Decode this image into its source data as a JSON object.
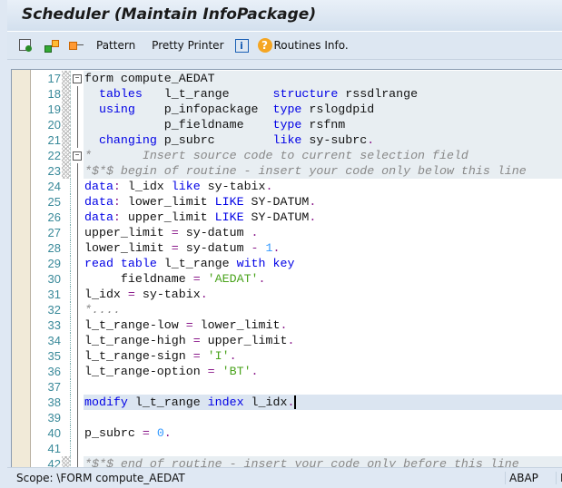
{
  "window": {
    "title": "Scheduler (Maintain InfoPackage)"
  },
  "toolbar": {
    "icons": [
      "check-syntax-icon",
      "activate-icon",
      "where-used-icon"
    ],
    "pattern": "Pattern",
    "pretty_printer": "Pretty Printer",
    "info_icon": "info-icon",
    "routines_info": "Routines Info."
  },
  "editor": {
    "lines": [
      {
        "n": "17",
        "ro": true,
        "fold": "open",
        "t": [
          [
            "form compute_AEDAT",
            "id"
          ]
        ]
      },
      {
        "n": "18",
        "ro": true,
        "t": [
          [
            "  ",
            ""
          ],
          [
            "tables",
            "kw"
          ],
          [
            "   l_t_range      ",
            "id"
          ],
          [
            "structure",
            "kw"
          ],
          [
            " rssdlrange",
            "id"
          ]
        ]
      },
      {
        "n": "19",
        "ro": true,
        "t": [
          [
            "  ",
            ""
          ],
          [
            "using",
            "kw"
          ],
          [
            "    p_infopackage  ",
            "id"
          ],
          [
            "type",
            "kw"
          ],
          [
            " rslogdpid",
            "id"
          ]
        ]
      },
      {
        "n": "20",
        "ro": true,
        "t": [
          [
            "           p_fieldname    ",
            "id"
          ],
          [
            "type",
            "kw"
          ],
          [
            " rsfnm",
            "id"
          ]
        ]
      },
      {
        "n": "21",
        "ro": true,
        "t": [
          [
            "  ",
            ""
          ],
          [
            "changing",
            "kw"
          ],
          [
            " p_subrc        ",
            "id"
          ],
          [
            "like",
            "kw"
          ],
          [
            " sy-subrc",
            "id"
          ],
          [
            ".",
            "op"
          ]
        ]
      },
      {
        "n": "22",
        "ro": true,
        "fold": "open",
        "t": [
          [
            "*       Insert source code to current selection field",
            "cm"
          ]
        ]
      },
      {
        "n": "23",
        "ro": true,
        "t": [
          [
            "*$*$ begin of routine - insert your code only below this line",
            "cm"
          ]
        ]
      },
      {
        "n": "24",
        "t": [
          [
            "data",
            "kw"
          ],
          [
            ":",
            "op"
          ],
          [
            " l_idx ",
            "id"
          ],
          [
            "like",
            "kw"
          ],
          [
            " sy-tabix",
            "id"
          ],
          [
            ".",
            "op"
          ]
        ]
      },
      {
        "n": "25",
        "t": [
          [
            "data",
            "kw"
          ],
          [
            ":",
            "op"
          ],
          [
            " lower_limit ",
            "id"
          ],
          [
            "LIKE",
            "kw"
          ],
          [
            " SY-DATUM",
            "id"
          ],
          [
            ".",
            "op"
          ]
        ]
      },
      {
        "n": "26",
        "t": [
          [
            "data",
            "kw"
          ],
          [
            ":",
            "op"
          ],
          [
            " upper_limit ",
            "id"
          ],
          [
            "LIKE",
            "kw"
          ],
          [
            " SY-DATUM",
            "id"
          ],
          [
            ".",
            "op"
          ]
        ]
      },
      {
        "n": "27",
        "t": [
          [
            "upper_limit ",
            "id"
          ],
          [
            "=",
            "op"
          ],
          [
            " sy-datum ",
            "id"
          ],
          [
            ".",
            "op"
          ]
        ]
      },
      {
        "n": "28",
        "t": [
          [
            "lower_limit ",
            "id"
          ],
          [
            "=",
            "op"
          ],
          [
            " sy-datum ",
            "id"
          ],
          [
            "-",
            "op"
          ],
          [
            " ",
            ""
          ],
          [
            "1",
            "num"
          ],
          [
            ".",
            "op"
          ]
        ]
      },
      {
        "n": "29",
        "t": [
          [
            "read",
            "kw"
          ],
          [
            " ",
            ""
          ],
          [
            "table",
            "kw"
          ],
          [
            " l_t_range ",
            "id"
          ],
          [
            "with",
            "kw"
          ],
          [
            " ",
            ""
          ],
          [
            "key",
            "kw"
          ]
        ]
      },
      {
        "n": "30",
        "t": [
          [
            "     fieldname ",
            "id"
          ],
          [
            "=",
            "op"
          ],
          [
            " ",
            ""
          ],
          [
            "'AEDAT'",
            "str"
          ],
          [
            ".",
            "op"
          ]
        ]
      },
      {
        "n": "31",
        "t": [
          [
            "l_idx ",
            "id"
          ],
          [
            "=",
            "op"
          ],
          [
            " sy-tabix",
            "id"
          ],
          [
            ".",
            "op"
          ]
        ]
      },
      {
        "n": "32",
        "t": [
          [
            "*....",
            "cm"
          ]
        ]
      },
      {
        "n": "33",
        "t": [
          [
            "l_t_range-low ",
            "id"
          ],
          [
            "=",
            "op"
          ],
          [
            " lower_limit",
            "id"
          ],
          [
            ".",
            "op"
          ]
        ]
      },
      {
        "n": "34",
        "t": [
          [
            "l_t_range-high ",
            "id"
          ],
          [
            "=",
            "op"
          ],
          [
            " upper_limit",
            "id"
          ],
          [
            ".",
            "op"
          ]
        ]
      },
      {
        "n": "35",
        "t": [
          [
            "l_t_range-sign ",
            "id"
          ],
          [
            "=",
            "op"
          ],
          [
            " ",
            ""
          ],
          [
            "'I'",
            "str"
          ],
          [
            ".",
            "op"
          ]
        ]
      },
      {
        "n": "36",
        "t": [
          [
            "l_t_range-option ",
            "id"
          ],
          [
            "=",
            "op"
          ],
          [
            " ",
            ""
          ],
          [
            "'BT'",
            "str"
          ],
          [
            ".",
            "op"
          ]
        ]
      },
      {
        "n": "37",
        "t": []
      },
      {
        "n": "38",
        "cur": true,
        "caret": true,
        "t": [
          [
            "modify",
            "kw"
          ],
          [
            " l_t_range ",
            "id"
          ],
          [
            "index",
            "kw"
          ],
          [
            " l_idx",
            "id"
          ],
          [
            ".",
            "op"
          ]
        ]
      },
      {
        "n": "39",
        "t": []
      },
      {
        "n": "40",
        "t": [
          [
            "p_subrc ",
            "id"
          ],
          [
            "=",
            "op"
          ],
          [
            " ",
            ""
          ],
          [
            "0",
            "num"
          ],
          [
            ".",
            "op"
          ]
        ]
      },
      {
        "n": "41",
        "t": []
      },
      {
        "n": "42",
        "ro": true,
        "t": [
          [
            "*$*$ end of routine - insert your code only before this line",
            "cm"
          ]
        ]
      }
    ]
  },
  "status": {
    "scope": "Scope: \\FORM compute_AEDAT",
    "language": "ABAP",
    "extra": "L"
  }
}
